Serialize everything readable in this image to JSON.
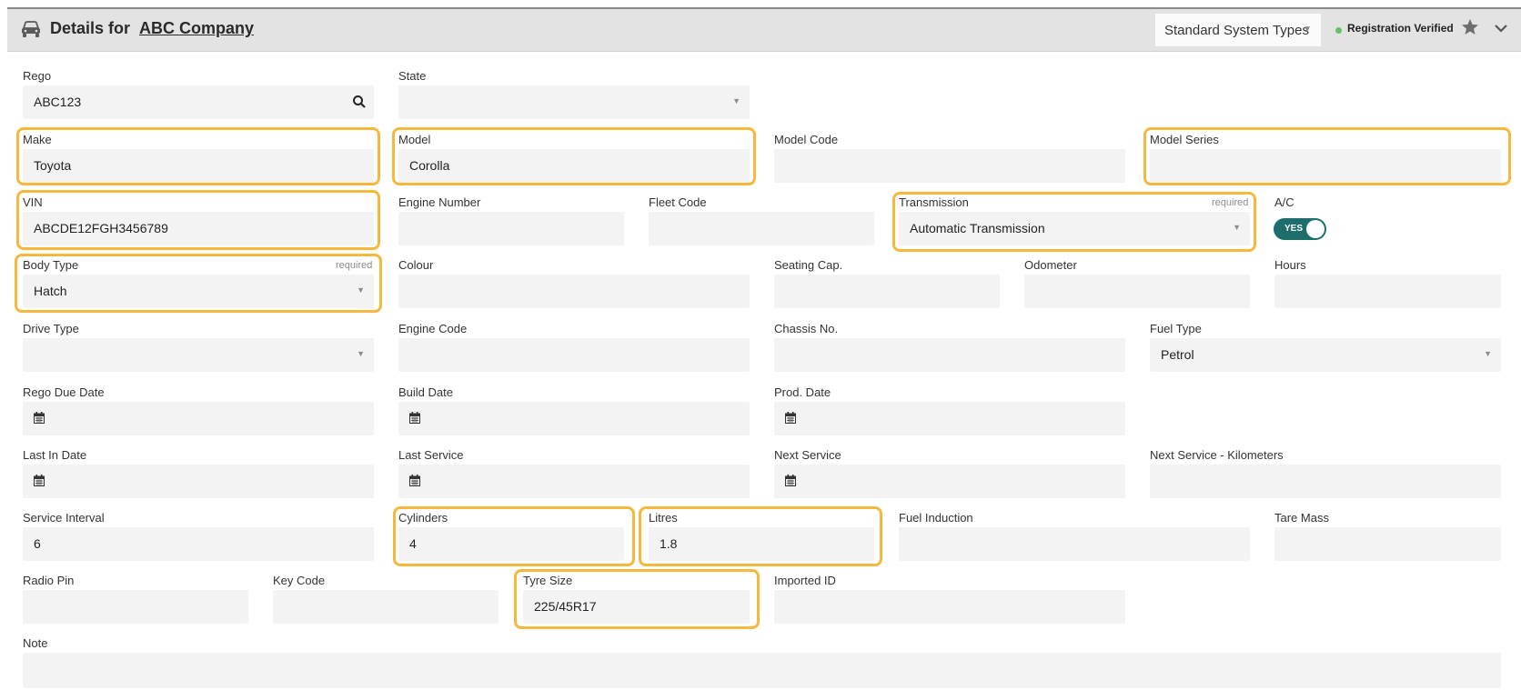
{
  "header": {
    "title_prefix": "Details for",
    "company": "ABC Company",
    "system_types": "Standard System Types",
    "status": "Registration Verified"
  },
  "icons": {
    "header": "car-icon",
    "favorite": "star-icon",
    "collapse": "chevron-down-icon",
    "rego_search": "search-icon",
    "date": "calendar-icon"
  },
  "colors": {
    "highlight": "#f6b83c",
    "toggle": "#1c6d6b",
    "verified": "#62c26a"
  },
  "fields": {
    "rego": {
      "label": "Rego",
      "value": "ABC123"
    },
    "state": {
      "label": "State",
      "value": ""
    },
    "make": {
      "label": "Make",
      "value": "Toyota"
    },
    "model": {
      "label": "Model",
      "value": "Corolla"
    },
    "model_code": {
      "label": "Model Code",
      "value": ""
    },
    "model_series": {
      "label": "Model Series",
      "value": ""
    },
    "vin": {
      "label": "VIN",
      "value": "ABCDE12FGH3456789"
    },
    "engine_number": {
      "label": "Engine Number",
      "value": ""
    },
    "fleet_code": {
      "label": "Fleet Code",
      "value": ""
    },
    "transmission": {
      "label": "Transmission",
      "required": "required",
      "value": "Automatic Transmission"
    },
    "ac": {
      "label": "A/C",
      "value": "YES"
    },
    "body_type": {
      "label": "Body Type",
      "required": "required",
      "value": "Hatch"
    },
    "colour": {
      "label": "Colour",
      "value": ""
    },
    "seating_cap": {
      "label": "Seating Cap.",
      "value": ""
    },
    "odometer": {
      "label": "Odometer",
      "value": ""
    },
    "hours": {
      "label": "Hours",
      "value": ""
    },
    "drive_type": {
      "label": "Drive Type",
      "value": ""
    },
    "engine_code": {
      "label": "Engine Code",
      "value": ""
    },
    "chassis_no": {
      "label": "Chassis No.",
      "value": ""
    },
    "fuel_type": {
      "label": "Fuel Type",
      "value": "Petrol"
    },
    "rego_due_date": {
      "label": "Rego Due Date",
      "value": ""
    },
    "build_date": {
      "label": "Build Date",
      "value": ""
    },
    "prod_date": {
      "label": "Prod. Date",
      "value": ""
    },
    "last_in_date": {
      "label": "Last In Date",
      "value": ""
    },
    "last_service": {
      "label": "Last Service",
      "value": ""
    },
    "next_service": {
      "label": "Next Service",
      "value": ""
    },
    "next_service_km": {
      "label": "Next Service - Kilometers",
      "value": ""
    },
    "service_interval": {
      "label": "Service Interval",
      "value": "6"
    },
    "cylinders": {
      "label": "Cylinders",
      "value": "4"
    },
    "litres": {
      "label": "Litres",
      "value": "1.8"
    },
    "fuel_induction": {
      "label": "Fuel Induction",
      "value": ""
    },
    "tare_mass": {
      "label": "Tare Mass",
      "value": ""
    },
    "radio_pin": {
      "label": "Radio Pin",
      "value": ""
    },
    "key_code": {
      "label": "Key Code",
      "value": ""
    },
    "tyre_size": {
      "label": "Tyre Size",
      "value": "225/45R17"
    },
    "imported_id": {
      "label": "Imported ID",
      "value": ""
    },
    "note": {
      "label": "Note",
      "value": ""
    }
  }
}
